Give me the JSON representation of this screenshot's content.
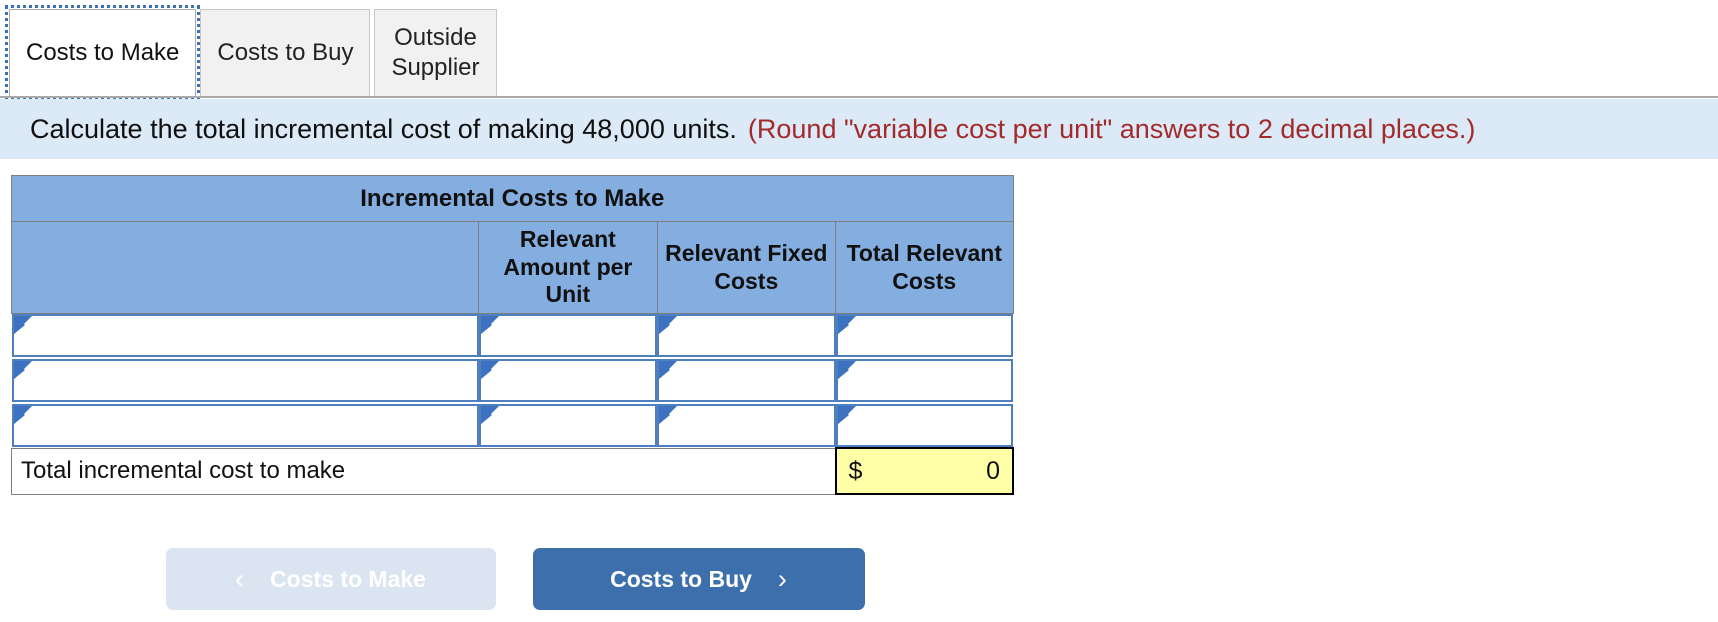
{
  "tabs": [
    {
      "label": "Costs to Make",
      "active": true
    },
    {
      "label": "Costs to Buy",
      "active": false
    },
    {
      "label": "Outside\nSupplier",
      "active": false
    }
  ],
  "instruction": {
    "main": "Calculate the total incremental cost of making 48,000 units.",
    "note": "(Round \"variable cost per unit\" answers to 2 decimal places.)"
  },
  "table": {
    "title": "Incremental Costs to Make",
    "columns": [
      "",
      "Relevant Amount per Unit",
      "Relevant Fixed Costs",
      "Total Relevant Costs"
    ],
    "rows": [
      {
        "description": "",
        "amount_per_unit": "",
        "fixed_costs": "",
        "total_costs": ""
      },
      {
        "description": "",
        "amount_per_unit": "",
        "fixed_costs": "",
        "total_costs": ""
      },
      {
        "description": "",
        "amount_per_unit": "",
        "fixed_costs": "",
        "total_costs": ""
      }
    ],
    "total": {
      "label": "Total incremental cost to make",
      "currency": "$",
      "value": "0"
    }
  },
  "nav": {
    "prev_label": "Costs to Make",
    "prev_chevron": "‹",
    "next_label": "Costs to Buy",
    "next_chevron": "›"
  },
  "colors": {
    "header_blue": "#85aee0",
    "banner_blue": "#dce9f7",
    "note_red": "#a32a2a",
    "answer_yellow": "#ffffa8",
    "primary_button": "#3e6fad",
    "disabled_button": "#dbe5f1",
    "cell_border_blue": "#4e7fbf"
  }
}
